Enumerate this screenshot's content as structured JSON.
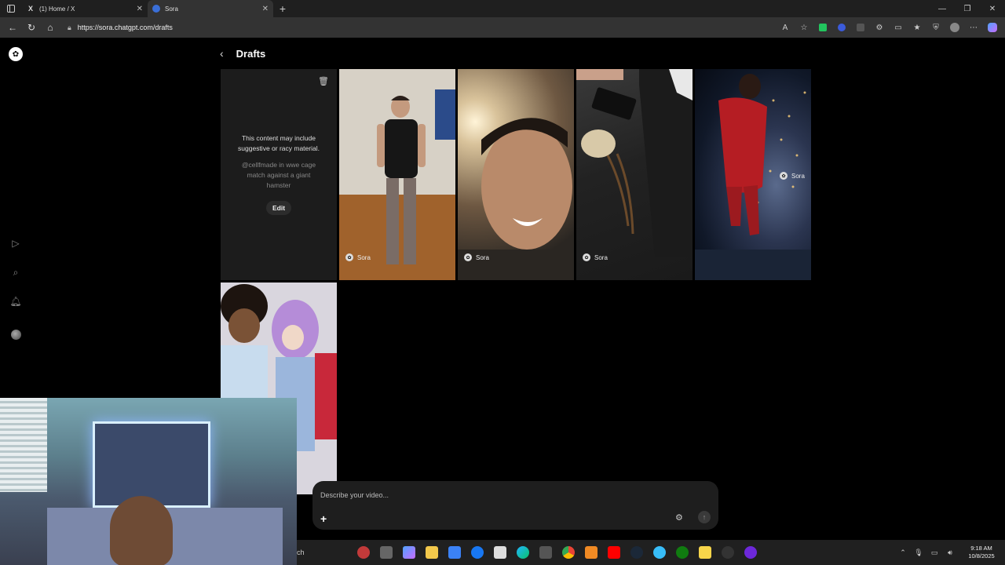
{
  "browser": {
    "tabs": [
      {
        "title": "(1) Home / X",
        "favicon": "x-logo-icon",
        "active": false
      },
      {
        "title": "Sora",
        "favicon": "sora-icon",
        "active": true
      }
    ],
    "url": "https://sora.chatgpt.com/drafts"
  },
  "page": {
    "title": "Drafts"
  },
  "drafts": {
    "blocked_tile": {
      "warning": "This content may include suggestive or racy material.",
      "prompt": "@cellfmade in wwe cage match against a giant hamster",
      "edit_label": "Edit"
    },
    "badge_label": "Sora"
  },
  "composer": {
    "placeholder": "Describe your video...",
    "plus_icon": "+",
    "settings_icon": "⚙",
    "send_icon": "↑"
  },
  "taskbar": {
    "search_text": "ch",
    "time": "9:18 AM",
    "date": "10/8/2025"
  }
}
